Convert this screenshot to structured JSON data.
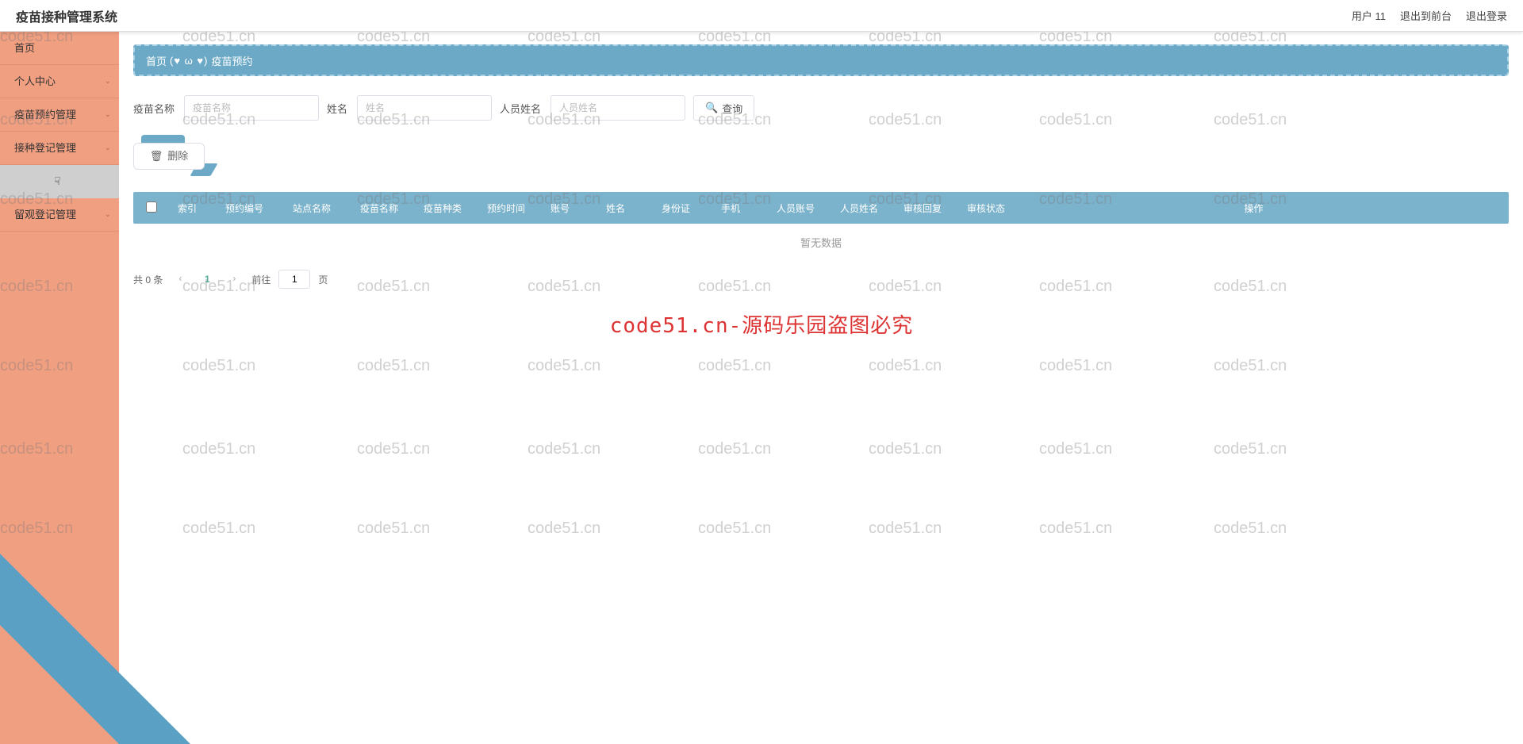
{
  "header": {
    "title": "疫苗接种管理系统",
    "user": "用户 11",
    "to_front": "退出到前台",
    "logout": "退出登录"
  },
  "sidebar": {
    "items": [
      {
        "label": "首页",
        "expandable": false
      },
      {
        "label": "个人中心",
        "expandable": true
      },
      {
        "label": "疫苗预约管理",
        "expandable": true
      },
      {
        "label": "接种登记管理",
        "expandable": true
      },
      {
        "label": "留观登记管理",
        "expandable": true
      }
    ]
  },
  "breadcrumb": {
    "home": "首页",
    "emoji": "(♥ ω ♥)",
    "current": "疫苗预约"
  },
  "search": {
    "label1": "疫苗名称",
    "ph1": "疫苗名称",
    "label2": "姓名",
    "ph2": "姓名",
    "label3": "人员姓名",
    "ph3": "人员姓名",
    "btn": "查询"
  },
  "actions": {
    "delete": "删除"
  },
  "table": {
    "headers": [
      "索引",
      "预约编号",
      "站点名称",
      "疫苗名称",
      "疫苗种类",
      "预约时间",
      "账号",
      "姓名",
      "身份证",
      "手机",
      "人员账号",
      "人员姓名",
      "审核回复",
      "审核状态"
    ],
    "op_header": "操作",
    "empty": "暂无数据"
  },
  "pagination": {
    "total": "共 0 条",
    "current": "1",
    "goto": "前往",
    "goto_val": "1",
    "unit": "页"
  },
  "watermark": {
    "repeat": "code51.cn",
    "center": "code51.cn-源码乐园盗图必究"
  }
}
